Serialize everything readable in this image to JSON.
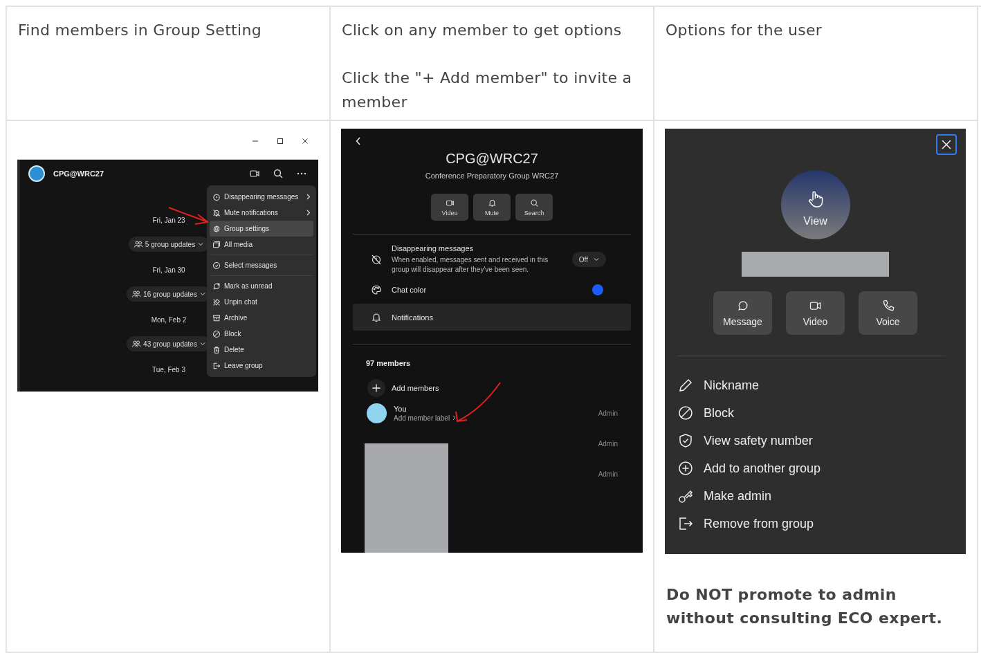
{
  "header_row": [
    {
      "paragraphs": [
        "Find members in Group Setting"
      ]
    },
    {
      "paragraphs": [
        "Click on any member to get options",
        "Click the \"+ Add member\" to invite a member"
      ]
    },
    {
      "paragraphs": [
        "Options for the user"
      ]
    }
  ],
  "chat_window": {
    "title": "CPG@WRC27",
    "timeline": [
      {
        "kind": "date",
        "text": "Fri, Jan 23"
      },
      {
        "kind": "updates",
        "text": "5 group updates"
      },
      {
        "kind": "date",
        "text": "Fri, Jan 30"
      },
      {
        "kind": "updates",
        "text": "16 group updates"
      },
      {
        "kind": "date",
        "text": "Mon, Feb 2"
      },
      {
        "kind": "updates",
        "text": "43 group updates"
      },
      {
        "kind": "date",
        "text": "Tue, Feb 3"
      }
    ],
    "menu": [
      [
        {
          "label": "Disappearing messages",
          "submenu": true,
          "selected": false
        },
        {
          "label": "Mute notifications",
          "submenu": true,
          "selected": false
        },
        {
          "label": "Group settings",
          "submenu": false,
          "selected": true
        },
        {
          "label": "All media",
          "submenu": false,
          "selected": false
        }
      ],
      [
        {
          "label": "Select messages",
          "submenu": false,
          "selected": false
        }
      ],
      [
        {
          "label": "Mark as unread",
          "submenu": false,
          "selected": false
        },
        {
          "label": "Unpin chat",
          "submenu": false,
          "selected": false
        },
        {
          "label": "Archive",
          "submenu": false,
          "selected": false
        },
        {
          "label": "Block",
          "submenu": false,
          "selected": false
        },
        {
          "label": "Delete",
          "submenu": false,
          "selected": false
        },
        {
          "label": "Leave group",
          "submenu": false,
          "selected": false
        }
      ]
    ]
  },
  "group_settings": {
    "title": "CPG@WRC27",
    "subtitle": "Conference Preparatory Group WRC27",
    "actions": [
      "Video",
      "Mute",
      "Search"
    ],
    "disappearing": {
      "title": "Disappearing messages",
      "description": "When enabled, messages sent and received in this group will disappear after they've been seen.",
      "value": "Off"
    },
    "chat_color": {
      "label": "Chat color",
      "color": "#1a5cf5"
    },
    "notifications": {
      "label": "Notifications",
      "highlighted": true
    },
    "members_count": "97 members",
    "add_members": "Add members",
    "members": [
      {
        "kind": "profile",
        "name": "You",
        "label": "Add member label",
        "role": "Admin"
      },
      {
        "kind": "redacted",
        "role": "Admin"
      },
      {
        "kind": "redacted",
        "role": "Admin"
      }
    ]
  },
  "member_options": {
    "avatar_label": "View",
    "actions": [
      "Message",
      "Video",
      "Voice"
    ],
    "options": [
      "Nickname",
      "Block",
      "View safety number",
      "Add to another group",
      "Make admin",
      "Remove from group"
    ]
  },
  "note": "Do NOT promote to admin without consulting ECO expert."
}
